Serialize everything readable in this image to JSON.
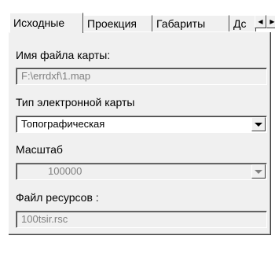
{
  "tabs": [
    {
      "label": "Исходные",
      "active": true
    },
    {
      "label": "Проекция",
      "active": false
    },
    {
      "label": "Габариты",
      "active": false
    },
    {
      "label": "Дс",
      "active": false
    }
  ],
  "tab_scroll": {
    "left": "◀",
    "right": "▶"
  },
  "map_file": {
    "label": "Имя файла карты:",
    "value": "F:\\errdxf\\1.map"
  },
  "map_type": {
    "label": "Тип электронной карты",
    "value": "Топографическая"
  },
  "scale": {
    "label": "Масштаб",
    "value": "100000"
  },
  "resource_file": {
    "label": "Файл ресурсов :",
    "value": "100tsir.rsc"
  }
}
